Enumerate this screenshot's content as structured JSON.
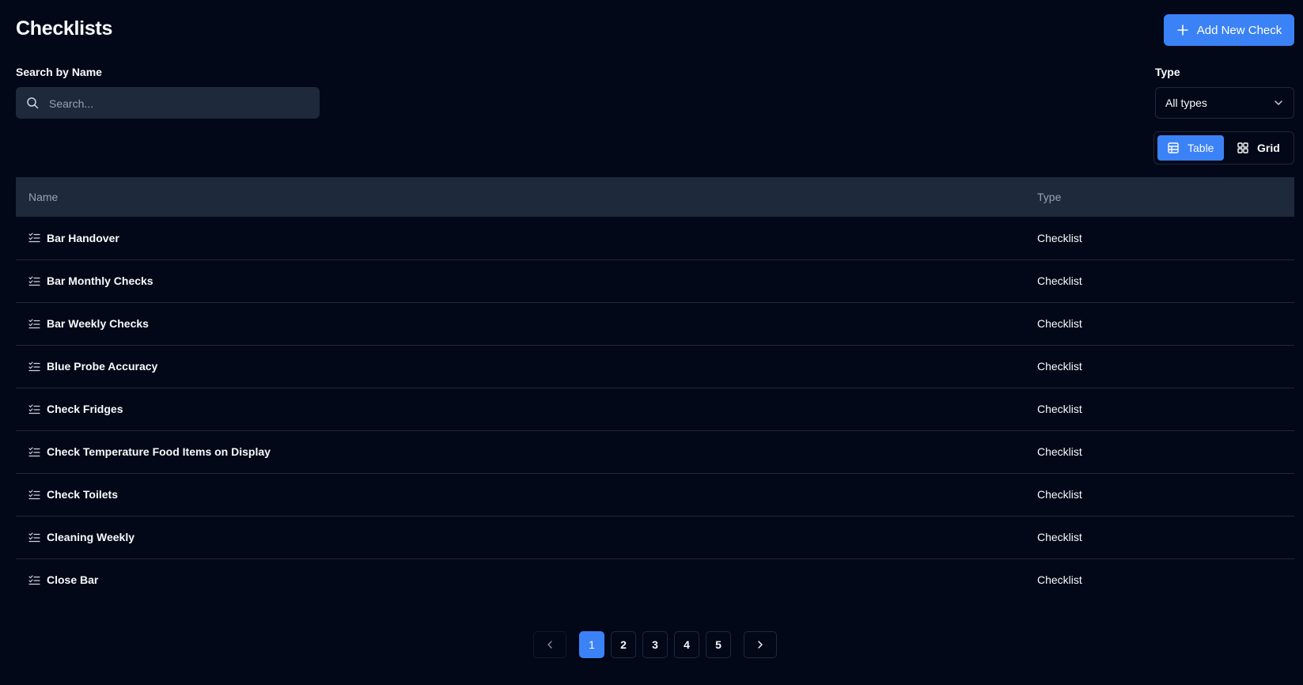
{
  "page": {
    "title": "Checklists"
  },
  "header": {
    "add_button_label": "Add New Check"
  },
  "search": {
    "label": "Search by Name",
    "placeholder": "Search...",
    "value": ""
  },
  "filter": {
    "label": "Type",
    "selected": "All types"
  },
  "view_toggle": {
    "table_label": "Table",
    "grid_label": "Grid",
    "active": "Table"
  },
  "table": {
    "headers": {
      "name": "Name",
      "type": "Type"
    },
    "rows": [
      {
        "name": "Bar Handover",
        "type": "Checklist"
      },
      {
        "name": "Bar Monthly Checks",
        "type": "Checklist"
      },
      {
        "name": "Bar Weekly Checks",
        "type": "Checklist"
      },
      {
        "name": "Blue Probe Accuracy",
        "type": "Checklist"
      },
      {
        "name": "Check Fridges",
        "type": "Checklist"
      },
      {
        "name": "Check Temperature Food Items on Display",
        "type": "Checklist"
      },
      {
        "name": "Check Toilets",
        "type": "Checklist"
      },
      {
        "name": "Cleaning Weekly",
        "type": "Checklist"
      },
      {
        "name": "Close Bar",
        "type": "Checklist"
      }
    ]
  },
  "pagination": {
    "pages": [
      "1",
      "2",
      "3",
      "4",
      "5"
    ],
    "current": "1"
  },
  "colors": {
    "background": "#020817",
    "accent": "#3b82f6",
    "surface": "#1e293b",
    "muted_text": "#94a3b8"
  },
  "icons": {
    "add": "plus-icon",
    "search": "search-icon",
    "select": "chevron-down-icon",
    "table_view": "table-icon",
    "grid_view": "grid-icon",
    "row": "list-checks-icon",
    "prev": "chevron-left-icon",
    "next": "chevron-right-icon"
  }
}
